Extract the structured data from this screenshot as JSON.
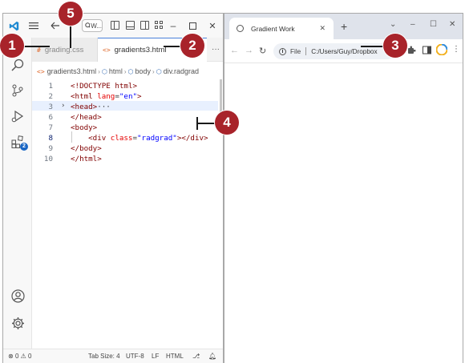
{
  "vscode": {
    "command_center_text": "W...",
    "tabs": [
      {
        "label": "grading.css",
        "icon": "#",
        "active": false
      },
      {
        "label": "gradients3.html",
        "icon": "<>",
        "active": true
      }
    ],
    "tab_more": "···",
    "breadcrumb": {
      "file": "gradients3.html",
      "items": [
        "html",
        "body",
        "div.radgrad"
      ]
    },
    "editor": {
      "lines": [
        {
          "num": "1",
          "text": "<!DOCTYPE html>"
        },
        {
          "num": "2",
          "text": "<html lang=\"en\">"
        },
        {
          "num": "3",
          "text": "<head>···"
        },
        {
          "num": "6",
          "text": "</head>"
        },
        {
          "num": "7",
          "text": "<body>"
        },
        {
          "num": "8",
          "text": "    <div class=\"radgrad\"></div>"
        },
        {
          "num": "9",
          "text": "</body>"
        },
        {
          "num": "10",
          "text": "</html>"
        }
      ],
      "current_line": "8"
    },
    "activity_badge": "2",
    "statusbar": {
      "errors": "0",
      "warnings": "0",
      "tab_size": "Tab Size: 4",
      "encoding": "UTF-8",
      "eol": "LF",
      "language": "HTML"
    }
  },
  "chrome": {
    "tab_title": "Gradient Work",
    "omnibox_scheme": "File",
    "omnibox_path": "C:/Users/Guy/Dropbox"
  },
  "callouts": [
    "1",
    "2",
    "3",
    "4",
    "5"
  ],
  "colors": {
    "callout": "#a8232a",
    "active_tab_border": "#4a7fd9",
    "tag": "#800000",
    "attr": "#e50000",
    "attr_value": "#0000ff",
    "badge": "#1a66c4"
  }
}
